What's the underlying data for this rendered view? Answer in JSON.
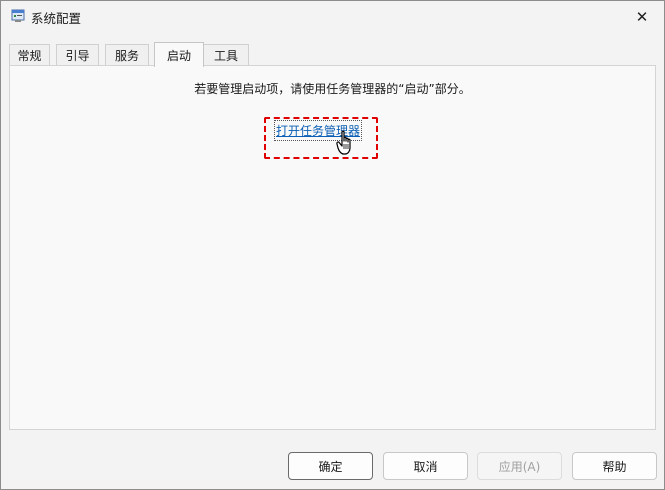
{
  "window": {
    "title": "系统配置",
    "close_symbol": "✕"
  },
  "tabs": [
    {
      "label": "常规"
    },
    {
      "label": "引导"
    },
    {
      "label": "服务"
    },
    {
      "label": "启动",
      "active": true
    },
    {
      "label": "工具"
    }
  ],
  "startup": {
    "message": "若要管理启动项，请使用任务管理器的“启动”部分。",
    "link_text": "打开任务管理器"
  },
  "buttons": {
    "ok": "确定",
    "cancel": "取消",
    "apply": "应用(A)",
    "help": "帮助"
  },
  "colors": {
    "link": "#0a5fb4",
    "highlight": "#e00000"
  },
  "icons": {
    "app": "msconfig-icon",
    "close": "close-icon",
    "cursor": "hand-pointer-icon"
  }
}
